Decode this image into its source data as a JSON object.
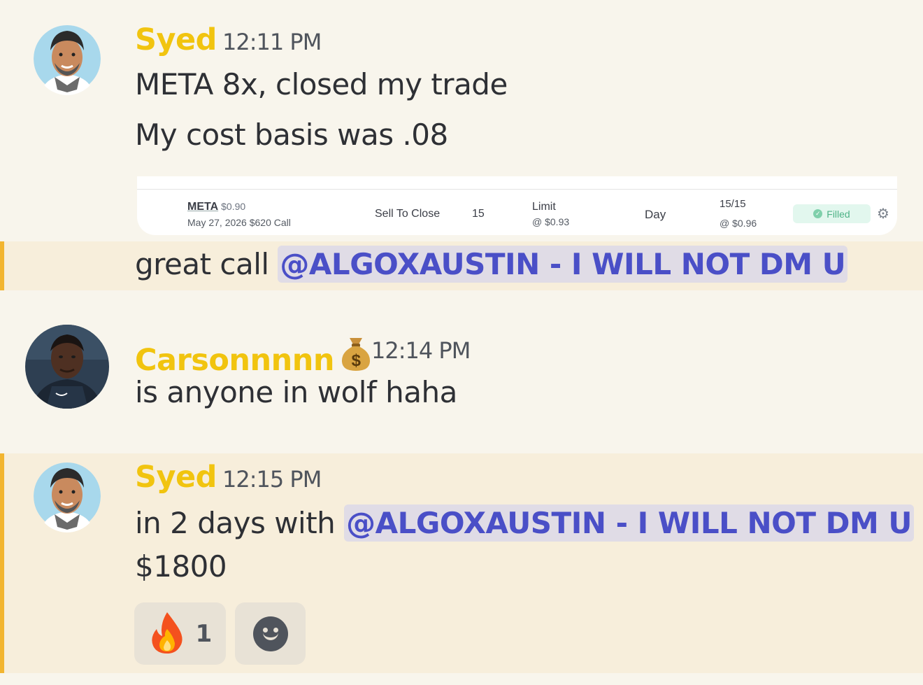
{
  "messages": [
    {
      "author": "Syed",
      "time": "12:11 PM",
      "lines": [
        "META 8x, closed my trade",
        "My cost basis was .08"
      ],
      "attachment": {
        "symbol": "META",
        "price": "$0.90",
        "contract": "May 27, 2026 $620 Call",
        "action": "Sell To Close",
        "quantity": "15",
        "order_type": "Limit",
        "limit_price": "@ $0.93",
        "time_in_force": "Day",
        "filled": "15/15",
        "avg_fill": "@ $0.96",
        "status": "Filled"
      }
    },
    {
      "text_prefix": "great call ",
      "mention": "@ALGOXAUSTIN - I WILL NOT DM U"
    },
    {
      "author": "Carsonnnnn",
      "time": "12:14 PM",
      "line": "is anyone in wolf haha"
    },
    {
      "author": "Syed",
      "time": "12:15 PM",
      "text_prefix": "in 2 days with ",
      "mention": "@ALGOXAUSTIN - I WILL NOT DM U",
      "line2": "$1800",
      "reactions": [
        {
          "emoji": "🔥",
          "count": "1",
          "icon": "fire-icon"
        }
      ]
    }
  ],
  "colors": {
    "background": "#f8f5ec",
    "highlight": "#f7eedb",
    "highlight_bar": "#f2b530",
    "username": "#f1c40f",
    "mention_text": "#4a4fc7",
    "mention_bg": "#e0dce6"
  }
}
